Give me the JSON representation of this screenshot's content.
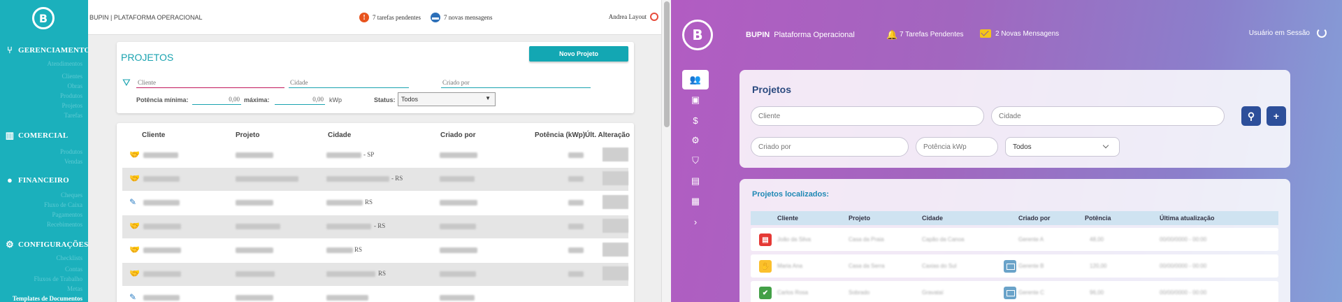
{
  "old_layout": {
    "sidebar": {
      "sections": [
        {
          "label": "GERENCIAMENTO",
          "icon": "branch-icon",
          "items": [
            "Atendimentos",
            "Clientes",
            "Obras",
            "Produtos",
            "Projetos",
            "Tarefas"
          ]
        },
        {
          "label": "COMERCIAL",
          "icon": "bar-chart-icon",
          "items": [
            "Produtos",
            "Vendas"
          ]
        },
        {
          "label": "FINANCEIRO",
          "icon": "money-bag-icon",
          "items": [
            "Cheques",
            "Fluxo de Caixa",
            "Pagamentos",
            "Recebimentos"
          ]
        },
        {
          "label": "CONFIGURAÇÕES",
          "icon": "gear-icon",
          "items": [
            "Checklists",
            "Contas",
            "Fluxos de Trabalho",
            "Metas",
            "Templates de Documentos"
          ]
        }
      ]
    },
    "topbar": {
      "brand": "BUPIN | PLATAFORMA OPERACIONAL",
      "tasks": "7 tarefas pendentes",
      "messages": "7 novas mensagens",
      "user": "Andrea Layout"
    },
    "filter": {
      "title": "PROJETOS",
      "new_button": "Novo Projeto",
      "client_placeholder": "Cliente",
      "city_placeholder": "Cidade",
      "creator_placeholder": "Criado por",
      "min_power_label": "Potência mínima:",
      "min_power_value": "0,00",
      "max_label": "máxima:",
      "max_value": "0,00",
      "unit": "kWp",
      "status_label": "Status:",
      "status_value": "Todos"
    },
    "table": {
      "headers": [
        "Cliente",
        "Projeto",
        "Cidade",
        "Criado por",
        "Potência (kWp)",
        "Últ. Alteração"
      ],
      "city_suffixes": [
        "- SP",
        "- RS",
        "RS",
        "- RS",
        "RS",
        "RS"
      ]
    }
  },
  "new_layout": {
    "header": {
      "brand_bold": "BUPIN",
      "brand_rest": "Plataforma Operacional",
      "tasks": "7 Tarefas Pendentes",
      "messages": "2 Novas Mensagens",
      "user": "Usuário em Sessão"
    },
    "nav_icons": [
      "user-settings-icon",
      "briefcase-icon",
      "dollar-icon",
      "gear-icon",
      "shield-icon",
      "clipboard-icon",
      "ledger-icon",
      "chevron-right-icon"
    ],
    "search": {
      "title": "Projetos",
      "client_placeholder": "Cliente",
      "city_placeholder": "Cidade",
      "creator_placeholder": "Criado por",
      "power_placeholder": "Potência kWp",
      "status_value": "Todos"
    },
    "results": {
      "title": "Projetos localizados:",
      "headers": [
        "Cliente",
        "Projeto",
        "Cidade",
        "Criado por",
        "Potência",
        "Última atualização"
      ],
      "rows": [
        {
          "tag_color": "#e53935",
          "client": "João da Silva",
          "project": "Casa da Praia",
          "city": "Capão da Canoa",
          "creator": "Gerente A",
          "power": "48,00",
          "updated": "00/00/0000 - 00:00"
        },
        {
          "tag_color": "#fbc02d",
          "client": "Maria Ana",
          "project": "Casa da Serra",
          "city": "Caxias do Sul",
          "creator": "Gerente B",
          "power": "120,00",
          "updated": "00/00/0000 - 00:00"
        },
        {
          "tag_color": "#43a047",
          "client": "Carlos Rosa",
          "project": "Sobrado",
          "city": "Gravataí",
          "creator": "Gerente C",
          "power": "96,00",
          "updated": "00/00/0000 - 00:00"
        }
      ]
    }
  }
}
